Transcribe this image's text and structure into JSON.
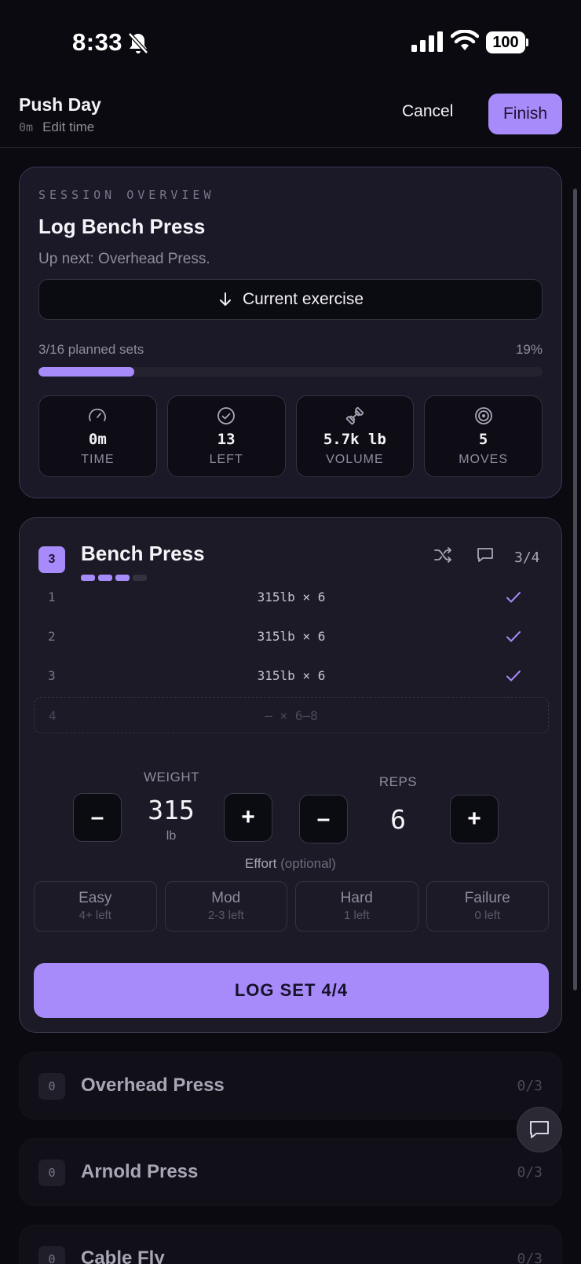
{
  "status_bar": {
    "time": "8:33",
    "battery": "100"
  },
  "header": {
    "title": "Push Day",
    "elapsed": "0m",
    "edit_time": "Edit time",
    "cancel": "Cancel",
    "finish": "Finish"
  },
  "overview": {
    "label": "SESSION OVERVIEW",
    "title": "Log Bench Press",
    "up_next": "Up next: Overhead Press.",
    "current_exercise_button": "Current exercise",
    "progress_text": "3/16 planned sets",
    "progress_percent": "19%",
    "progress_fraction": 0.19,
    "stats": [
      {
        "icon": "gauge-icon",
        "value": "0m",
        "label": "TIME"
      },
      {
        "icon": "check-circle-icon",
        "value": "13",
        "label": "LEFT"
      },
      {
        "icon": "dumbbell-icon",
        "value": "5.7k lb",
        "label": "VOLUME"
      },
      {
        "icon": "target-icon",
        "value": "5",
        "label": "MOVES"
      }
    ]
  },
  "exercise": {
    "number": "3",
    "name": "Bench Press",
    "progress": "3/4",
    "sets_done": 3,
    "sets_total": 4,
    "sets": [
      {
        "num": "1",
        "desc": "315lb × 6",
        "done": true
      },
      {
        "num": "2",
        "desc": "315lb × 6",
        "done": true
      },
      {
        "num": "3",
        "desc": "315lb × 6",
        "done": true
      },
      {
        "num": "4",
        "desc": "— × 6–8",
        "done": false
      }
    ],
    "weight_label": "WEIGHT",
    "weight_value": "315",
    "weight_unit": "lb",
    "reps_label": "REPS",
    "reps_value": "6",
    "minus": "–",
    "plus": "+",
    "effort_label": "Effort",
    "effort_optional": "(optional)",
    "efforts": [
      {
        "title": "Easy",
        "sub": "4+ left"
      },
      {
        "title": "Mod",
        "sub": "2-3 left"
      },
      {
        "title": "Hard",
        "sub": "1 left"
      },
      {
        "title": "Failure",
        "sub": "0 left"
      }
    ],
    "log_button": "LOG SET 4/4"
  },
  "upcoming": [
    {
      "badge": "0",
      "name": "Overhead Press",
      "count": "0/3"
    },
    {
      "badge": "0",
      "name": "Arnold Press",
      "count": "0/3"
    },
    {
      "badge": "0",
      "name": "Cable Fly",
      "count": "0/3"
    }
  ],
  "colors": {
    "accent": "#a88bfa",
    "background": "#0a0a10",
    "card": "#1b1828"
  }
}
